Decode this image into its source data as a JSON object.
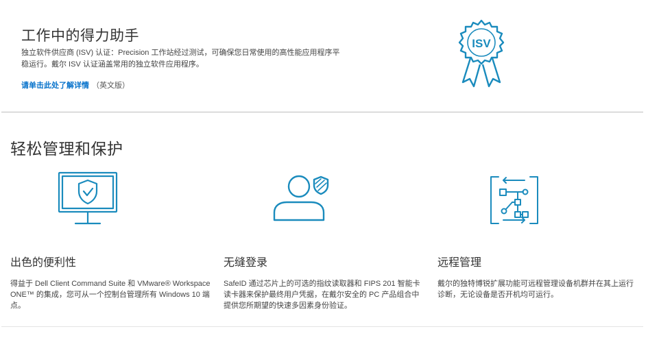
{
  "isv": {
    "title": "工作中的得力助手",
    "description": "独立软件供应商 (ISV) 认证：Precision 工作站经过测试，可确保您日常使用的高性能应用程序平稳运行。戴尔 ISV 认证涵盖常用的独立软件应用程序。",
    "link_label": "请单击此处了解详情",
    "link_suffix": "（英文版）",
    "badge_text": "ISV",
    "badge_icon": "isv-ribbon-icon"
  },
  "manage": {
    "title": "轻松管理和保护",
    "features": [
      {
        "icon": "monitor-shield-icon",
        "title": "出色的便利性",
        "description": "得益于 Dell Client Command Suite 和 VMware® Workspace ONE™ 的集成，您可从一个控制台管理所有 Windows 10 端点。"
      },
      {
        "icon": "user-shield-icon",
        "title": "无缝登录",
        "description": "SafeID 通过芯片上的可选的指纹读取器和 FIPS 201 智能卡读卡器来保护最终用户凭据，在戴尔安全的 PC 产品组合中提供您所期望的快速多因素身份验证。"
      },
      {
        "icon": "network-diagram-icon",
        "title": "远程管理",
        "description": "戴尔的独特博锐扩展功能可远程管理设备机群并在其上运行诊断，无论设备是否开机均可运行。"
      }
    ]
  },
  "colors": {
    "accent_blue": "#0672cb",
    "icon_blue": "#1a8bbd"
  }
}
